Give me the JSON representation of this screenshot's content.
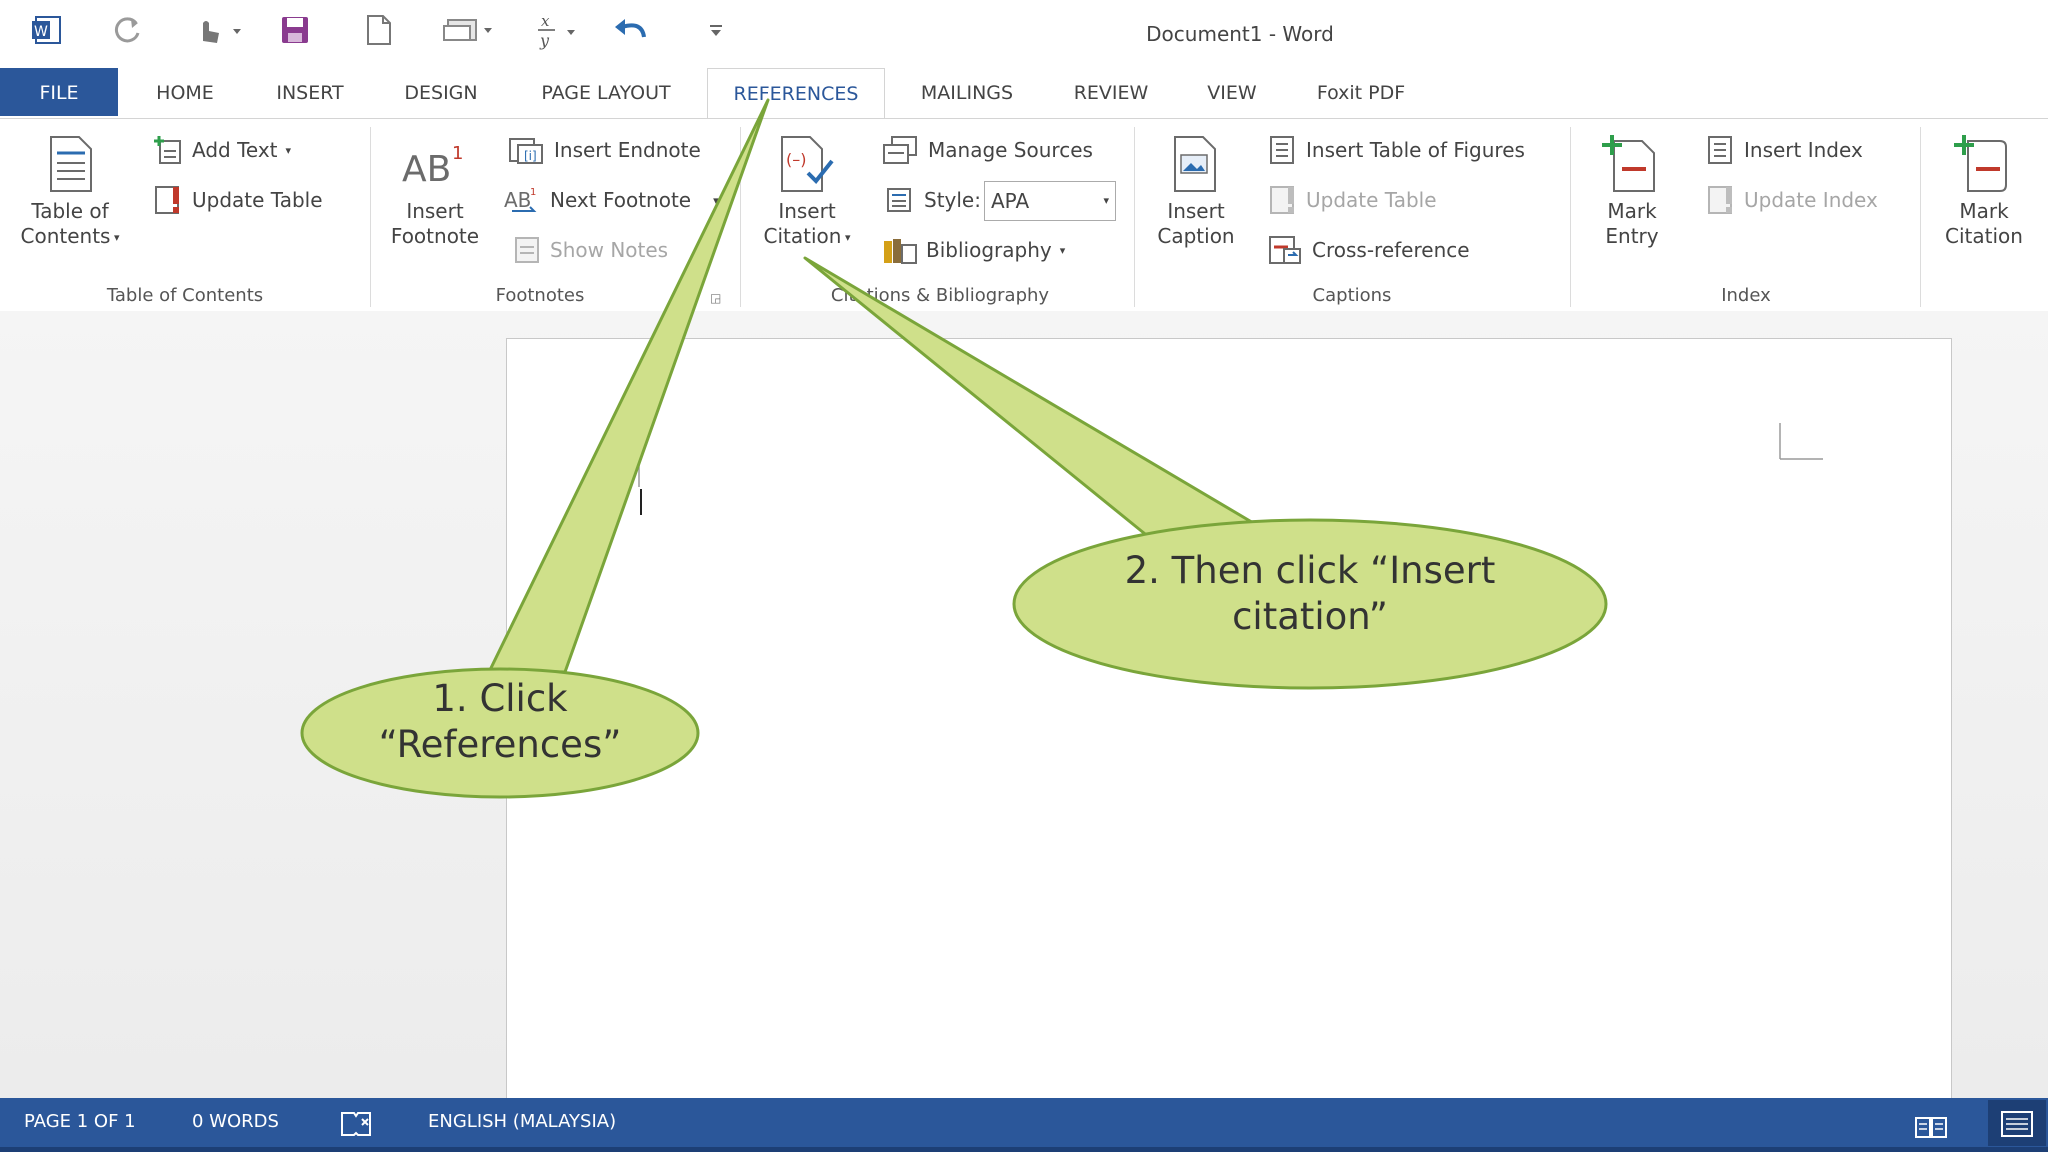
{
  "window": {
    "title": "Document1 - Word"
  },
  "quick_access": {
    "icons": [
      "word-app-icon",
      "redo-icon",
      "touch-mode-icon",
      "save-icon",
      "new-document-icon",
      "print-preview-icon",
      "equation-icon",
      "undo-icon",
      "customize-toolbar-icon"
    ]
  },
  "tabs": [
    {
      "label": "FILE"
    },
    {
      "label": "HOME"
    },
    {
      "label": "INSERT"
    },
    {
      "label": "DESIGN"
    },
    {
      "label": "PAGE LAYOUT"
    },
    {
      "label": "REFERENCES",
      "active": true
    },
    {
      "label": "MAILINGS"
    },
    {
      "label": "REVIEW"
    },
    {
      "label": "VIEW"
    },
    {
      "label": "Foxit PDF"
    }
  ],
  "ribbon": {
    "toc": {
      "big_line1": "Table of",
      "big_line2": "Contents",
      "add_text": "Add Text",
      "update_table": "Update Table",
      "group": "Table of Contents"
    },
    "footnotes": {
      "big_line1": "Insert",
      "big_line2": "Footnote",
      "insert_endnote": "Insert Endnote",
      "next_footnote": "Next Footnote",
      "show_notes": "Show Notes",
      "group": "Footnotes"
    },
    "citations": {
      "big_line1": "Insert",
      "big_line2": "Citation",
      "manage_sources": "Manage Sources",
      "style_label": "Style:",
      "style_value": "APA",
      "bibliography": "Bibliography",
      "group": "Citations & Bibliography"
    },
    "captions": {
      "big_line1": "Insert",
      "big_line2": "Caption",
      "insert_table_of_figures": "Insert Table of Figures",
      "update_table": "Update Table",
      "cross_reference": "Cross-reference",
      "group": "Captions"
    },
    "index": {
      "big_line1": "Mark",
      "big_line2": "Entry",
      "insert_index": "Insert Index",
      "update_index": "Update Index",
      "group": "Index"
    },
    "toa": {
      "big_line1": "Mark",
      "big_line2": "Citation"
    }
  },
  "status": {
    "page": "PAGE 1 OF 1",
    "words": "0 WORDS",
    "language": "ENGLISH (MALAYSIA)"
  },
  "callouts": {
    "one_line1": "1. Click",
    "one_line2": "“References”",
    "two_line1": "2. Then click “Insert",
    "two_line2": "citation”",
    "fill": "#cfe08a",
    "stroke": "#7aa53a"
  },
  "colors": {
    "accent": "#2b579a"
  }
}
